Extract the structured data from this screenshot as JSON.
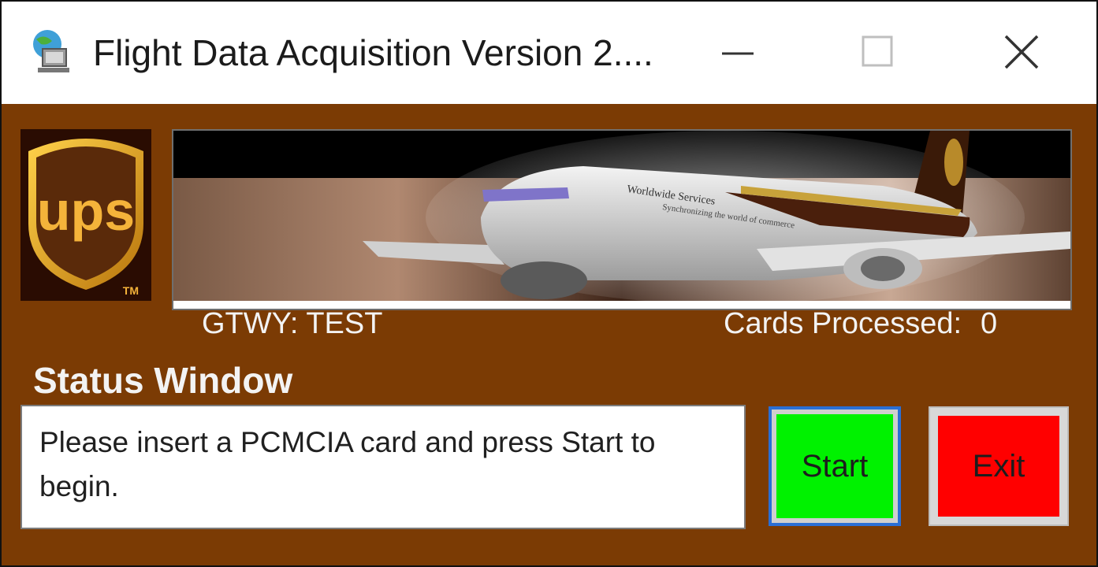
{
  "window": {
    "title": "Flight Data Acquisition Version 2....",
    "minimize_icon": "minimize-icon",
    "maximize_icon": "maximize-icon",
    "close_icon": "close-icon"
  },
  "logo": {
    "brand": "UPS",
    "text": "ups",
    "trademark": "TM"
  },
  "banner": {
    "image": "cargo-airplane-banner",
    "tail_accent": "#5b2a0b"
  },
  "info": {
    "gateway_label": "GTWY: TEST",
    "cards_label": "Cards Processed:",
    "cards_count": "0"
  },
  "status": {
    "heading": "Status Window",
    "message": "Please insert a PCMCIA card and press Start to begin."
  },
  "buttons": {
    "start_label": "Start",
    "exit_label": "Exit"
  },
  "colors": {
    "background": "#7b3b04",
    "start": "#00f200",
    "exit": "#ff0000",
    "focus": "#2a6fd6"
  }
}
